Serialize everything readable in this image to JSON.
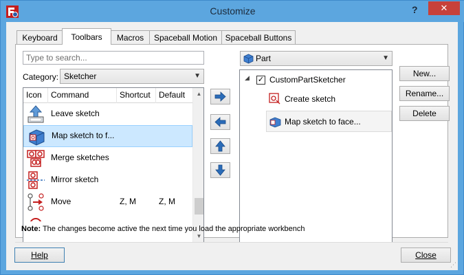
{
  "window": {
    "title": "Customize",
    "help_glyph": "?",
    "close_glyph": "✕"
  },
  "tabs": [
    {
      "label": "Keyboard"
    },
    {
      "label": "Toolbars"
    },
    {
      "label": "Macros"
    },
    {
      "label": "Spaceball Motion"
    },
    {
      "label": "Spaceball Buttons"
    }
  ],
  "left": {
    "search_placeholder": "Type to search...",
    "category_label": "Category:",
    "category_value": "Sketcher",
    "columns": [
      "Icon",
      "Command",
      "Shortcut",
      "Default"
    ],
    "rows": [
      {
        "icon": "leave-sketch-icon",
        "command": "Leave sketch",
        "shortcut": "",
        "default": ""
      },
      {
        "icon": "map-sketch-icon",
        "command": "Map sketch to f...",
        "shortcut": "",
        "default": ""
      },
      {
        "icon": "merge-sketches-icon",
        "command": "Merge sketches",
        "shortcut": "",
        "default": ""
      },
      {
        "icon": "mirror-sketch-icon",
        "command": "Mirror sketch",
        "shortcut": "",
        "default": ""
      },
      {
        "icon": "move-icon",
        "command": "Move",
        "shortcut": "Z, M",
        "default": "Z, M"
      }
    ]
  },
  "right": {
    "workbench_value": "Part",
    "tree": {
      "toolbar_name": "CustomPartSketcher",
      "checked": true,
      "items": [
        {
          "icon": "create-sketch-icon",
          "label": "Create sketch"
        },
        {
          "icon": "map-sketch-icon",
          "label": "Map sketch to face..."
        }
      ]
    },
    "buttons": [
      "New...",
      "Rename...",
      "Delete"
    ]
  },
  "note": {
    "bold": "Note:",
    "text": " The changes become active the next time you load the appropriate workbench"
  },
  "footer": {
    "help_label": "Help",
    "close_label": "Close"
  },
  "colors": {
    "titlebar": "#5ca6df",
    "close_button": "#c7413a",
    "selection": "#cce8ff",
    "arrow_blue": "#2b6cb8"
  }
}
